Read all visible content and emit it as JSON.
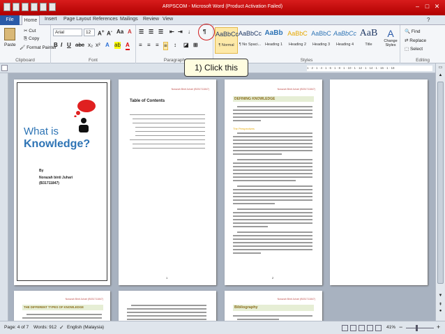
{
  "window": {
    "title": "ARPSCOM - Microsoft Word (Product Activation Failed)"
  },
  "tabs": [
    "File",
    "Home",
    "Insert",
    "Page Layout",
    "References",
    "Mailings",
    "Review",
    "View"
  ],
  "clipboard": {
    "label": "Clipboard",
    "paste": "Paste",
    "cut": "Cut",
    "copy": "Copy",
    "format_painter": "Format Painter"
  },
  "font": {
    "label": "Font",
    "name": "Arial",
    "size": "12"
  },
  "paragraph": {
    "label": "Paragraph"
  },
  "styles": {
    "label": "Styles",
    "items": [
      {
        "sample": "AaBbCc",
        "name": "¶ Normal"
      },
      {
        "sample": "AaBbCc",
        "name": "¶ No Spaci..."
      },
      {
        "sample": "AaBb",
        "name": "Heading 1"
      },
      {
        "sample": "AaBbC",
        "name": "Heading 2"
      },
      {
        "sample": "AaBbC",
        "name": "Heading 3"
      },
      {
        "sample": "AaBbCc",
        "name": "Heading 4"
      },
      {
        "sample": "AaB",
        "name": "Title"
      }
    ],
    "change_styles": "Change Styles"
  },
  "editing": {
    "label": "Editing",
    "find": "Find",
    "replace": "Replace",
    "select": "Select"
  },
  "pilcrow": "¶",
  "callout": "1) Click this",
  "ruler": "1 · 2 · 1 · 4 · 1 · 6 · 1 · 8 · 1 · 10 · 1 · 12 · 1 · 14 · 1 · 16 · 1 · 18",
  "pages": {
    "cover": {
      "line1": "What is",
      "line2": "Knowledge?",
      "by": "By",
      "author": "Norazah binti Juhari",
      "id": "(B31711847)"
    },
    "toc": {
      "title": "Table of Contents",
      "header": "Norazah Binti Juhari (B031711847)"
    },
    "defining": {
      "heading": "DEFINING KNOWLEDGE",
      "sub": "The Perspectives",
      "header": "Norazah Binti Juhari (B031711847)"
    },
    "types": {
      "heading": "THE DIFFERENT TYPES OF KNOWLEDGE",
      "header": "Norazah Binti Juhari (B031711847)"
    },
    "biblio": {
      "heading": "Bibliography",
      "header": "Norazah Binti Juhari (B031711847)"
    },
    "page_numbers": {
      "toc": "1",
      "defining": "2"
    }
  },
  "status": {
    "page": "Page: 4 of 7",
    "words": "Words: 912",
    "language": "English (Malaysia)",
    "zoom": "41%"
  },
  "colors": {
    "accent_red": "#c00000",
    "heading_green": "#9bbb59",
    "ribbon_blue": "#2a5aa8"
  }
}
